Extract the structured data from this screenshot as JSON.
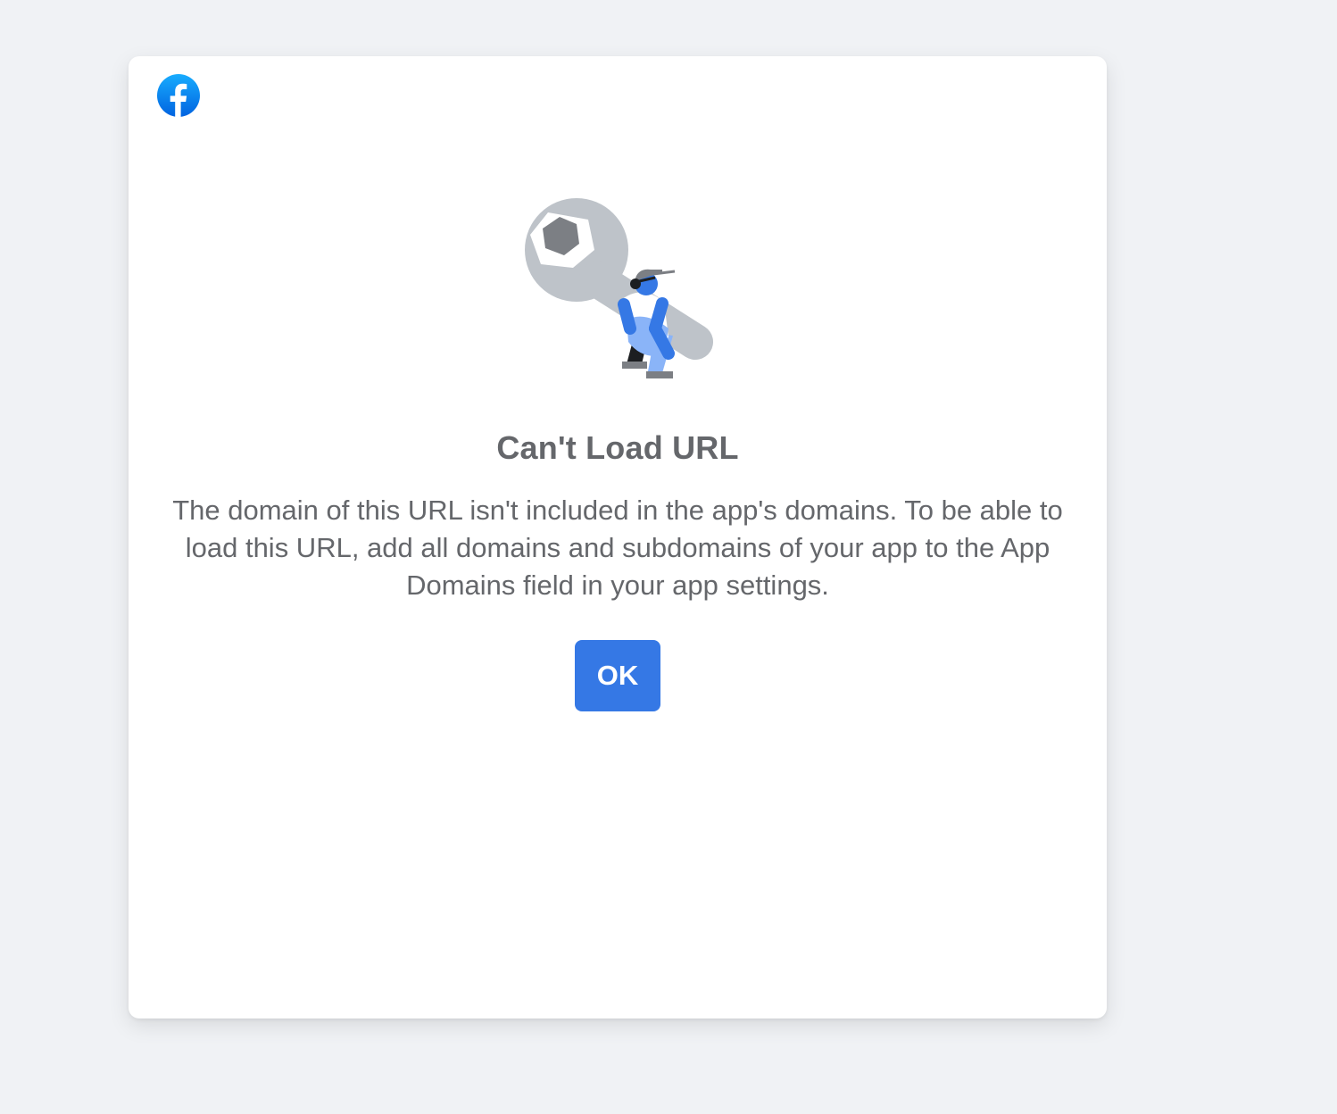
{
  "dialog": {
    "logo_icon": "facebook-logo-icon",
    "illustration_icon": "wrench-worker-illustration",
    "title": "Can't Load URL",
    "message": "The domain of this URL isn't included in the app's domains. To be able to load this URL, add all domains and subdomains of your app to the App Domains field in your app settings.",
    "ok_label": "OK"
  },
  "colors": {
    "background": "#f0f2f5",
    "card": "#ffffff",
    "text": "#65676b",
    "button": "#3578e5",
    "brand": "#1877f2"
  }
}
